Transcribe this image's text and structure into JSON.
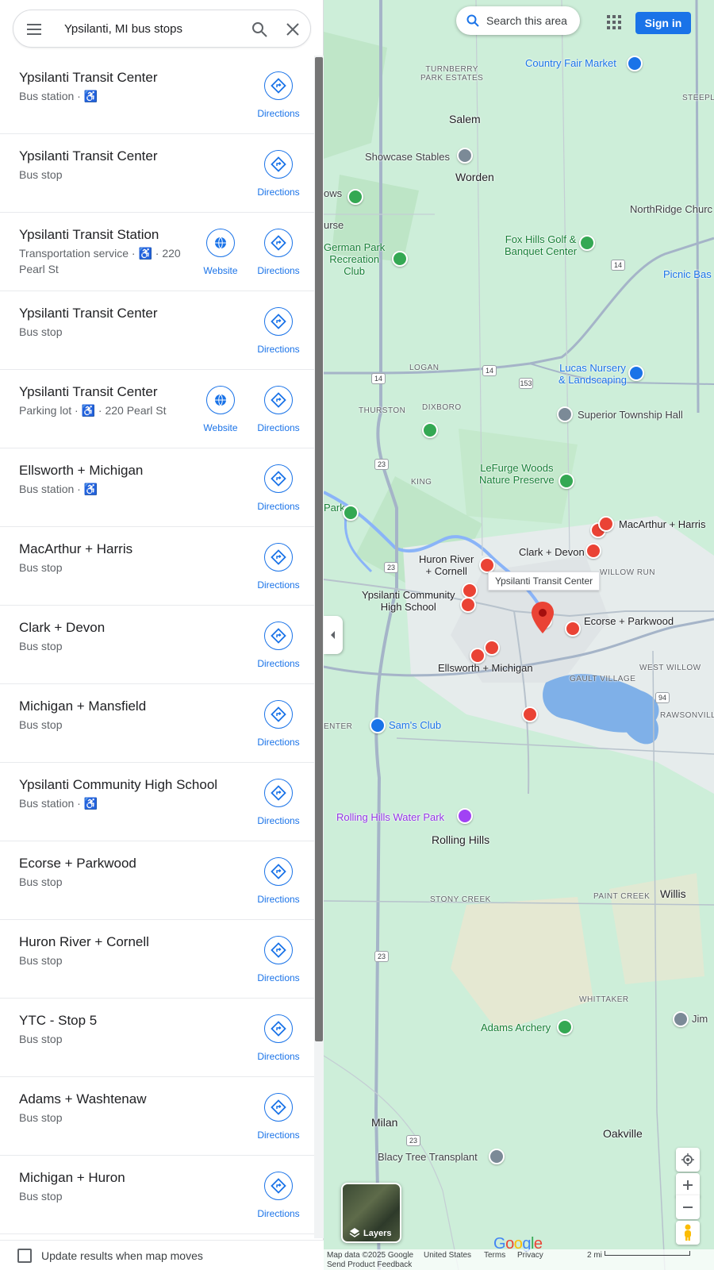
{
  "search": {
    "query": "Ypsilanti, MI bus stops"
  },
  "results": [
    {
      "name": "Ypsilanti Transit Center",
      "sub": "Bus station · ♿",
      "website": false
    },
    {
      "name": "Ypsilanti Transit Center",
      "sub": "Bus stop",
      "website": false
    },
    {
      "name": "Ypsilanti Transit Station",
      "sub": "Transportation service · ♿ · 220 Pearl St",
      "website": true
    },
    {
      "name": "Ypsilanti Transit Center",
      "sub": "Bus stop",
      "website": false
    },
    {
      "name": "Ypsilanti Transit Center",
      "sub": "Parking lot · ♿ · 220 Pearl St",
      "website": true
    },
    {
      "name": "Ellsworth + Michigan",
      "sub": "Bus station · ♿",
      "website": false
    },
    {
      "name": "MacArthur + Harris",
      "sub": "Bus stop",
      "website": false
    },
    {
      "name": "Clark + Devon",
      "sub": "Bus stop",
      "website": false
    },
    {
      "name": "Michigan + Mansfield",
      "sub": "Bus stop",
      "website": false
    },
    {
      "name": "Ypsilanti Community High School",
      "sub": "Bus station · ♿",
      "website": false
    },
    {
      "name": "Ecorse + Parkwood",
      "sub": "Bus stop",
      "website": false
    },
    {
      "name": "Huron River + Cornell",
      "sub": "Bus stop",
      "website": false
    },
    {
      "name": "YTC - Stop 5",
      "sub": "Bus stop",
      "website": false
    },
    {
      "name": "Adams + Washtenaw",
      "sub": "Bus stop",
      "website": false
    },
    {
      "name": "Michigan + Huron",
      "sub": "Bus stop",
      "website": false
    }
  ],
  "labels": {
    "directions": "Directions",
    "website": "Website"
  },
  "footer": {
    "update_results": "Update results when map moves"
  },
  "map": {
    "search_area": "Search this area",
    "sign_in": "Sign in",
    "layers": "Layers",
    "tooltip": "Ypsilanti Transit Center",
    "logo": "Google",
    "attribution": {
      "data": "Map data ©2025 Google",
      "country": "United States",
      "terms": "Terms",
      "privacy": "Privacy",
      "scale": "2 mi",
      "feedback": "Send Product Feedback"
    },
    "places": {
      "country_fair_market": "Country Fair Market",
      "turnberry": "TURNBERRY\nPARK ESTATES",
      "salem": "Salem",
      "steepl": "STEEPL",
      "showcase": "Showcase Stables",
      "worden": "Worden",
      "ows": "ows",
      "urse": "urse",
      "northridge": "NorthRidge Churc",
      "german_park": "German Park\nRecreation\nClub",
      "fox_hills": "Fox Hills Golf &\nBanquet Center",
      "picnic": "Picnic Bas",
      "logan": "LOGAN",
      "lucas": "Lucas Nursery\n& Landscaping",
      "thurston": "THURSTON",
      "dixboro": "DIXBORO",
      "superior": "Superior Township Hall",
      "king": "KING",
      "lefurge": "LeFurge Woods\nNature Preserve",
      "park": "Park",
      "macarthur": "MacArthur + Harris",
      "clark": "Clark + Devon",
      "huron_river": "Huron River\n+ Cornell",
      "willow_run": "WILLOW RUN",
      "ychs": "Ypsilanti Community\nHigh School",
      "ecorse": "Ecorse + Parkwood",
      "ellsworth": "Ellsworth + Michigan",
      "gault": "GAULT VILLAGE",
      "west_willow": "WEST WILLOW",
      "enter": "ENTER",
      "sams": "Sam's Club",
      "rawsonville": "RAWSONVILL",
      "rolling_hills_wp": "Rolling Hills Water Park",
      "rolling_hills": "Rolling Hills",
      "stony_creek": "STONY CREEK",
      "paint_creek": "PAINT CREEK",
      "willis": "Willis",
      "whittaker": "WHITTAKER",
      "adams_archery": "Adams Archery",
      "jim": "Jim",
      "milan": "Milan",
      "oakville": "Oakville",
      "blacy": "Blacy Tree Transplant"
    },
    "highways": [
      "14",
      "14",
      "14",
      "153",
      "23",
      "23",
      "23",
      "23",
      "94"
    ]
  },
  "colors": {
    "accent": "#1a73e8",
    "pin_red": "#ea4335",
    "map_bg": "#cfeee0"
  }
}
